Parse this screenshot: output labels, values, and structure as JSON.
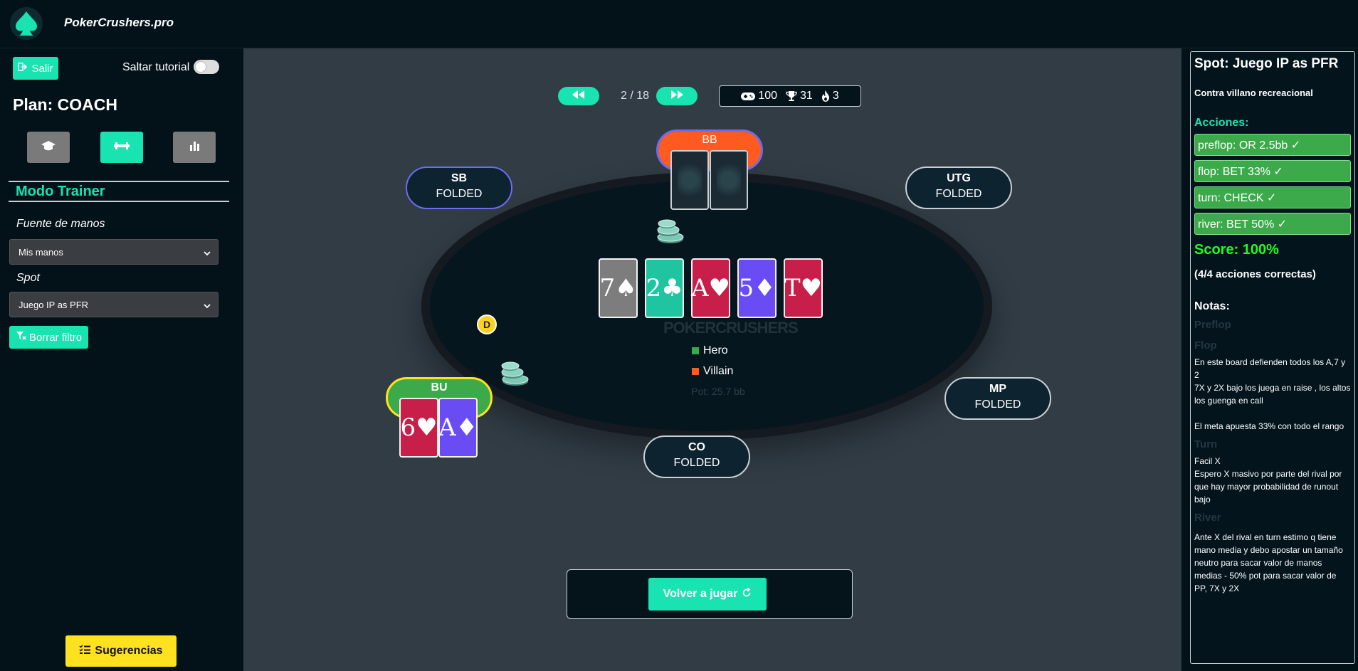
{
  "app": {
    "title": "PokerCrushers.pro"
  },
  "sidebar": {
    "exit_label": "Salir",
    "tutorial_label": "Saltar tutorial",
    "plan": "Plan: COACH",
    "mode_title": "Modo Trainer",
    "source_label": "Fuente de manos",
    "source_value": "Mis manos",
    "spot_label": "Spot",
    "spot_value": "Juego IP as PFR",
    "clear_filter_label": "Borrar filtro",
    "suggestions_label": "Sugerencias"
  },
  "toolbar": {
    "counter": "2 / 18",
    "hands": "100",
    "trophies": "31",
    "streak": "3"
  },
  "table": {
    "seats": {
      "sb": {
        "pos": "SB",
        "status": "FOLDED"
      },
      "utg": {
        "pos": "UTG",
        "status": "FOLDED"
      },
      "mp": {
        "pos": "MP",
        "status": "FOLDED"
      },
      "co": {
        "pos": "CO",
        "status": "FOLDED"
      },
      "bb": {
        "pos": "BB"
      },
      "bu": {
        "pos": "BU"
      }
    },
    "board": [
      {
        "card": "7♠",
        "color": "#7d7d7d"
      },
      {
        "card": "2♣",
        "color": "#1fc4a0"
      },
      {
        "card": "A♥",
        "color": "#c81e4a"
      },
      {
        "card": "5♦",
        "color": "#6a4cf5"
      },
      {
        "card": "T♥",
        "color": "#c81e4a"
      }
    ],
    "hero_cards": [
      {
        "card": "6♥",
        "color": "#c81e4a"
      },
      {
        "card": "A♦",
        "color": "#6a4cf5"
      }
    ],
    "dealer": "D",
    "watermark": "POKERCRUSHERS",
    "legend_hero": "Hero",
    "legend_villain": "Villain",
    "hero_color": "#3caa4a",
    "villain_color": "#ff5a1f",
    "pot": "Pot: 25.7 bb"
  },
  "play_again_label": "Volver a jugar",
  "panel": {
    "title": "Spot: Juego IP as PFR",
    "subtitle": "Contra villano recreacional",
    "actions_heading": "Acciones:",
    "actions": [
      "preflop: OR 2.5bb ✓",
      "flop: BET 33% ✓",
      "turn: CHECK ✓",
      "river: BET 50% ✓"
    ],
    "score": "Score: 100%",
    "correct": "(4/4 acciones correctas)",
    "notes_heading": "Notas:",
    "notes": {
      "preflop_h": "Preflop",
      "flop_h": "Flop",
      "flop_1": "En este board defienden todos los A,7 y 2",
      "flop_2": "7X y 2X bajo los juega en raise , los altos los guenga en call",
      "flop_3": "El meta apuesta 33% con todo el rango",
      "turn_h": "Turn",
      "turn_1": "Facil X",
      "turn_2": "Espero X masivo por parte del rival por que hay mayor probabilidad de runout bajo",
      "river_h": "River",
      "river_1": "Ante X del rival en turn estimo q tiene mano media y debo apostar un tamaño neutro para sacar valor de manos medias - 50% pot para sacar valor de PP, 7X y 2X"
    }
  }
}
